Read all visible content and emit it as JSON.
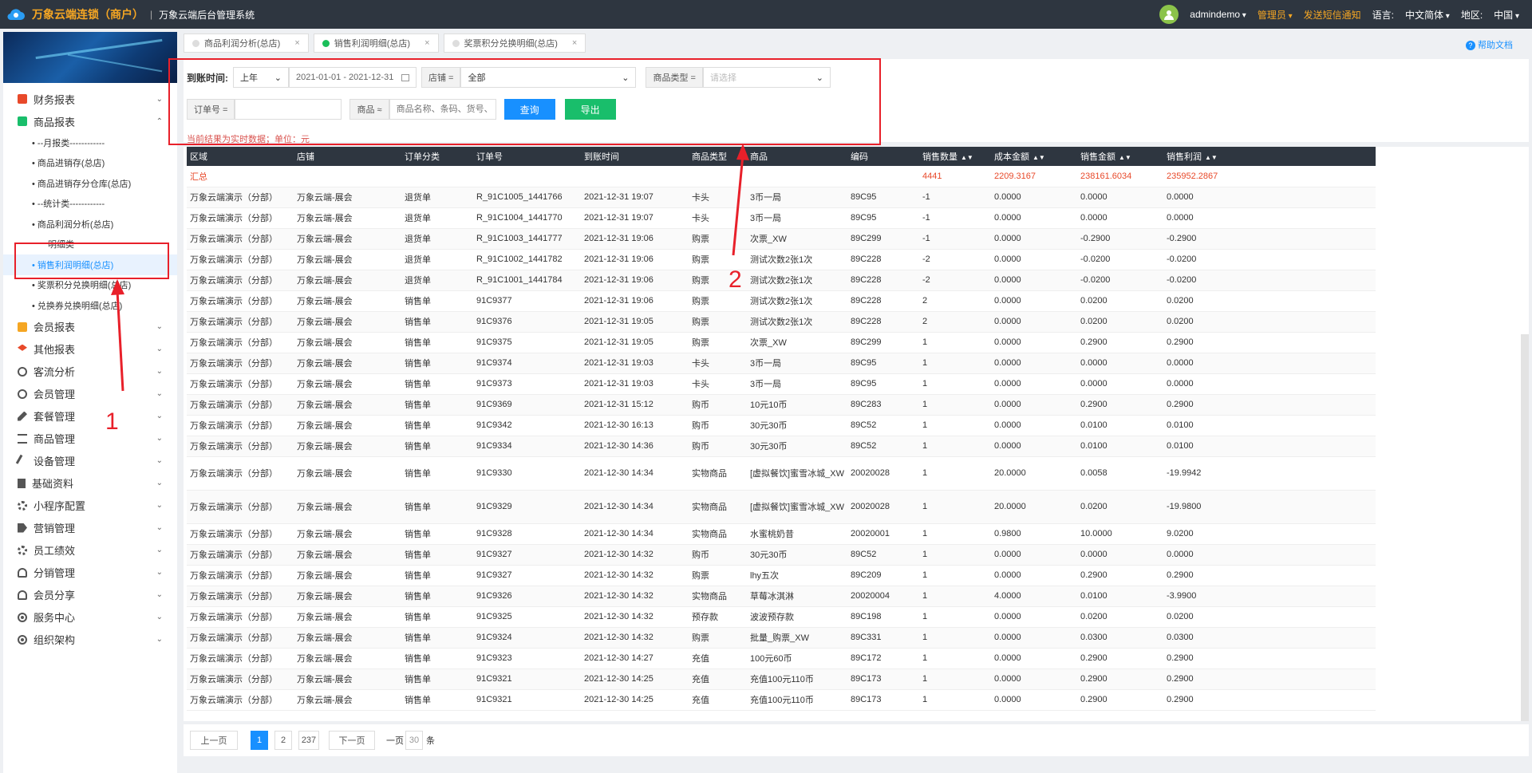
{
  "topbar": {
    "brand": "万象云端连锁（商户）",
    "subtitle": "万象云端后台管理系统",
    "user": "admindemo",
    "role": "管理员",
    "sms": "发送短信通知",
    "lang_label": "语言:",
    "lang_value": "中文简体",
    "region_label": "地区:",
    "region_value": "中国"
  },
  "sidebar": {
    "groups": [
      {
        "label": "财务报表",
        "icon": "finance-report-icon",
        "color": "#e8492a"
      },
      {
        "label": "商品报表",
        "icon": "goods-report-icon",
        "color": "#19be6b",
        "expanded": true
      }
    ],
    "subs": [
      "• --月报类------------",
      "• 商品进销存(总店)",
      "• 商品进销存分仓库(总店)",
      "• --统计类------------",
      "• 商品利润分析(总店)",
      "明细类",
      "• 销售利润明细(总店)",
      "• 奖票积分兑换明细(总店)",
      "• 兑换券兑换明细(总店)"
    ],
    "groups2": [
      {
        "label": "会员报表",
        "icon": "member-report-icon",
        "color": "#f5a623"
      },
      {
        "label": "其他报表",
        "icon": "layers-icon",
        "color": "#e8492a"
      },
      {
        "label": "客流分析",
        "icon": "target-icon",
        "color": "#555"
      },
      {
        "label": "会员管理",
        "icon": "user-icon",
        "color": "#555"
      },
      {
        "label": "套餐管理",
        "icon": "edit-icon",
        "color": "#555"
      },
      {
        "label": "商品管理",
        "icon": "swap-icon",
        "color": "#555"
      },
      {
        "label": "设备管理",
        "icon": "wrench-icon",
        "color": "#555"
      },
      {
        "label": "基础资料",
        "icon": "file-icon",
        "color": "#555"
      },
      {
        "label": "小程序配置",
        "icon": "settings-icon",
        "color": "#555"
      },
      {
        "label": "营销管理",
        "icon": "tag-icon",
        "color": "#555"
      },
      {
        "label": "员工绩效",
        "icon": "gear-icon",
        "color": "#555"
      },
      {
        "label": "分销管理",
        "icon": "users-icon",
        "color": "#555"
      },
      {
        "label": "会员分享",
        "icon": "share-users-icon",
        "color": "#555"
      },
      {
        "label": "服务中心",
        "icon": "radio-icon",
        "color": "#555"
      },
      {
        "label": "组织架构",
        "icon": "radio-icon",
        "color": "#555"
      }
    ]
  },
  "tabs": [
    {
      "label": "商品利润分析(总店)",
      "active": false
    },
    {
      "label": "销售利润明细(总店)",
      "active": true
    },
    {
      "label": "奖票积分兑换明细(总店)",
      "active": false
    }
  ],
  "help": "帮助文档",
  "filters": {
    "time_label": "到账时间:",
    "period": "上年",
    "date_range": "2021-01-01 - 2021-12-31",
    "store_label": "店铺 =",
    "store_value": "全部",
    "type_label": "商品类型 =",
    "type_placeholder": "请选择",
    "order_label": "订单号 =",
    "goods_label": "商品 ≈",
    "goods_placeholder": "商品名称、条码、货号、",
    "query": "查询",
    "export": "导出",
    "note": "当前结果为实时数据；单位：元"
  },
  "table": {
    "headers": [
      "区域",
      "店铺",
      "订单分类",
      "订单号",
      "到账时间",
      "商品类型",
      "商品",
      "编码",
      "销售数量",
      "成本金额",
      "销售金额",
      "销售利润"
    ],
    "summary": {
      "label": "汇总",
      "qty": "4441",
      "cost": "2209.3167",
      "sales": "238161.6034",
      "profit": "235952.2867"
    },
    "rows": [
      [
        "万象云端演示（分部）",
        "万象云端-展会",
        "退货单",
        "R_91C1005_1441766",
        "2021-12-31 19:07",
        "卡头",
        "3币一局",
        "89C95",
        "-1",
        "0.0000",
        "0.0000",
        "0.0000"
      ],
      [
        "万象云端演示（分部）",
        "万象云端-展会",
        "退货单",
        "R_91C1004_1441770",
        "2021-12-31 19:07",
        "卡头",
        "3币一局",
        "89C95",
        "-1",
        "0.0000",
        "0.0000",
        "0.0000"
      ],
      [
        "万象云端演示（分部）",
        "万象云端-展会",
        "退货单",
        "R_91C1003_1441777",
        "2021-12-31 19:06",
        "购票",
        "次票_XW",
        "89C299",
        "-1",
        "0.0000",
        "-0.2900",
        "-0.2900"
      ],
      [
        "万象云端演示（分部）",
        "万象云端-展会",
        "退货单",
        "R_91C1002_1441782",
        "2021-12-31 19:06",
        "购票",
        "测试次数2张1次",
        "89C228",
        "-2",
        "0.0000",
        "-0.0200",
        "-0.0200"
      ],
      [
        "万象云端演示（分部）",
        "万象云端-展会",
        "退货单",
        "R_91C1001_1441784",
        "2021-12-31 19:06",
        "购票",
        "测试次数2张1次",
        "89C228",
        "-2",
        "0.0000",
        "-0.0200",
        "-0.0200"
      ],
      [
        "万象云端演示（分部）",
        "万象云端-展会",
        "销售单",
        "91C9377",
        "2021-12-31 19:06",
        "购票",
        "测试次数2张1次",
        "89C228",
        "2",
        "0.0000",
        "0.0200",
        "0.0200"
      ],
      [
        "万象云端演示（分部）",
        "万象云端-展会",
        "销售单",
        "91C9376",
        "2021-12-31 19:05",
        "购票",
        "测试次数2张1次",
        "89C228",
        "2",
        "0.0000",
        "0.0200",
        "0.0200"
      ],
      [
        "万象云端演示（分部）",
        "万象云端-展会",
        "销售单",
        "91C9375",
        "2021-12-31 19:05",
        "购票",
        "次票_XW",
        "89C299",
        "1",
        "0.0000",
        "0.2900",
        "0.2900"
      ],
      [
        "万象云端演示（分部）",
        "万象云端-展会",
        "销售单",
        "91C9374",
        "2021-12-31 19:03",
        "卡头",
        "3币一局",
        "89C95",
        "1",
        "0.0000",
        "0.0000",
        "0.0000"
      ],
      [
        "万象云端演示（分部）",
        "万象云端-展会",
        "销售单",
        "91C9373",
        "2021-12-31 19:03",
        "卡头",
        "3币一局",
        "89C95",
        "1",
        "0.0000",
        "0.0000",
        "0.0000"
      ],
      [
        "万象云端演示（分部）",
        "万象云端-展会",
        "销售单",
        "91C9369",
        "2021-12-31 15:12",
        "购币",
        "10元10币",
        "89C283",
        "1",
        "0.0000",
        "0.2900",
        "0.2900"
      ],
      [
        "万象云端演示（分部）",
        "万象云端-展会",
        "销售单",
        "91C9342",
        "2021-12-30 16:13",
        "购币",
        "30元30币",
        "89C52",
        "1",
        "0.0000",
        "0.0100",
        "0.0100"
      ],
      [
        "万象云端演示（分部）",
        "万象云端-展会",
        "销售单",
        "91C9334",
        "2021-12-30 14:36",
        "购币",
        "30元30币",
        "89C52",
        "1",
        "0.0000",
        "0.0100",
        "0.0100"
      ],
      [
        "万象云端演示（分部）",
        "万象云端-展会",
        "销售单",
        "91C9330",
        "2021-12-30 14:34",
        "实物商品",
        "[虚拟餐饮]蜜雪冰城_XW",
        "20020028",
        "1",
        "20.0000",
        "0.0058",
        "-19.9942"
      ],
      [
        "万象云端演示（分部）",
        "万象云端-展会",
        "销售单",
        "91C9329",
        "2021-12-30 14:34",
        "实物商品",
        "[虚拟餐饮]蜜雪冰城_XW",
        "20020028",
        "1",
        "20.0000",
        "0.0200",
        "-19.9800"
      ],
      [
        "万象云端演示（分部）",
        "万象云端-展会",
        "销售单",
        "91C9328",
        "2021-12-30 14:34",
        "实物商品",
        "水蜜桃奶昔",
        "20020001",
        "1",
        "0.9800",
        "10.0000",
        "9.0200"
      ],
      [
        "万象云端演示（分部）",
        "万象云端-展会",
        "销售单",
        "91C9327",
        "2021-12-30 14:32",
        "购币",
        "30元30币",
        "89C52",
        "1",
        "0.0000",
        "0.0000",
        "0.0000"
      ],
      [
        "万象云端演示（分部）",
        "万象云端-展会",
        "销售单",
        "91C9327",
        "2021-12-30 14:32",
        "购票",
        "lhy五次",
        "89C209",
        "1",
        "0.0000",
        "0.2900",
        "0.2900"
      ],
      [
        "万象云端演示（分部）",
        "万象云端-展会",
        "销售单",
        "91C9326",
        "2021-12-30 14:32",
        "实物商品",
        "草莓冰淇淋",
        "20020004",
        "1",
        "4.0000",
        "0.0100",
        "-3.9900"
      ],
      [
        "万象云端演示（分部）",
        "万象云端-展会",
        "销售单",
        "91C9325",
        "2021-12-30 14:32",
        "预存款",
        "波波预存款",
        "89C198",
        "1",
        "0.0000",
        "0.0200",
        "0.0200"
      ],
      [
        "万象云端演示（分部）",
        "万象云端-展会",
        "销售单",
        "91C9324",
        "2021-12-30 14:32",
        "购票",
        "批量_购票_XW",
        "89C331",
        "1",
        "0.0000",
        "0.0300",
        "0.0300"
      ],
      [
        "万象云端演示（分部）",
        "万象云端-展会",
        "销售单",
        "91C9323",
        "2021-12-30 14:27",
        "充值",
        "100元60币",
        "89C172",
        "1",
        "0.0000",
        "0.2900",
        "0.2900"
      ],
      [
        "万象云端演示（分部）",
        "万象云端-展会",
        "销售单",
        "91C9321",
        "2021-12-30 14:25",
        "充值",
        "充值100元110币",
        "89C173",
        "1",
        "0.0000",
        "0.2900",
        "0.2900"
      ],
      [
        "万象云端演示（分部）",
        "万象云端-展会",
        "销售单",
        "91C9321",
        "2021-12-30 14:25",
        "充值",
        "充值100元110币",
        "89C173",
        "1",
        "0.0000",
        "0.2900",
        "0.2900"
      ]
    ]
  },
  "pager": {
    "prev": "上一页",
    "pages": [
      "1",
      "2",
      "237"
    ],
    "next": "下一页",
    "per_label": "一页",
    "per_value": "30",
    "unit": "条"
  },
  "annotations": {
    "one": "1",
    "two": "2"
  }
}
